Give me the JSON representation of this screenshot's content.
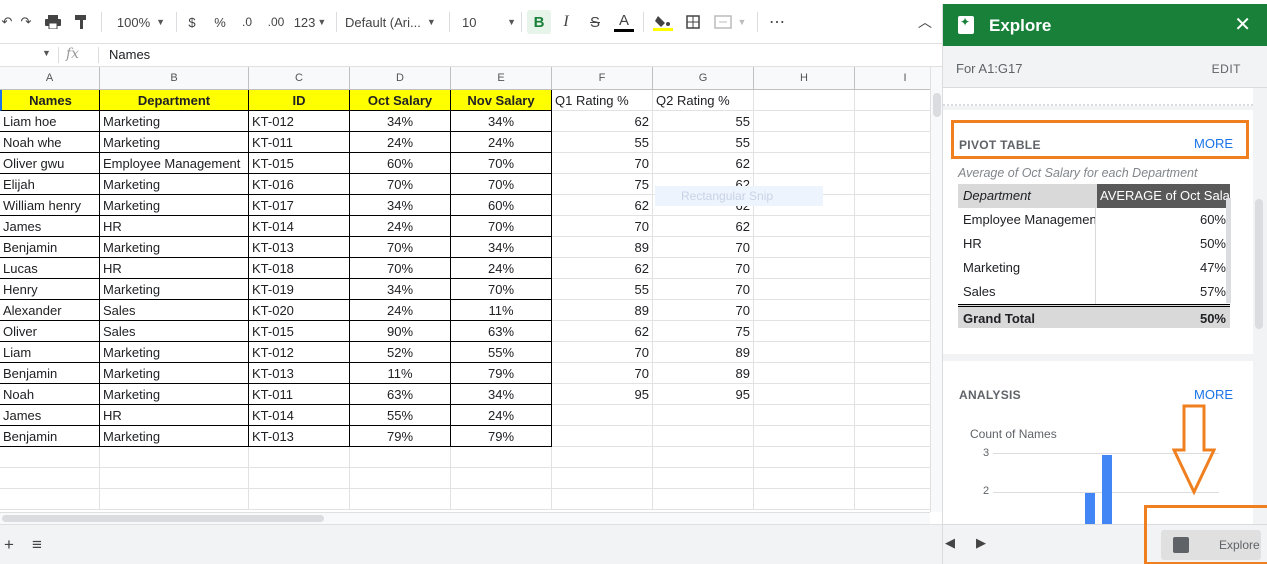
{
  "toolbar": {
    "zoom": "100%",
    "currency": "$",
    "percent": "%",
    "decrease_decimal": ".0",
    "increase_decimal": ".00",
    "number_format": "123",
    "font": "Default (Ari...",
    "font_size": "10",
    "bold": "B",
    "italic": "I",
    "strike": "S",
    "text_color": "A",
    "more": "⋯"
  },
  "formula_bar": {
    "value": "Names"
  },
  "columns": [
    "A",
    "B",
    "C",
    "D",
    "E",
    "F",
    "G",
    "H",
    "I"
  ],
  "headers": [
    "Names",
    "Department",
    "ID",
    "Oct Salary",
    "Nov Salary",
    "Q1 Rating %",
    "Q2 Rating %"
  ],
  "rows": [
    [
      "Liam hoe",
      "Marketing",
      "KT-012",
      "34%",
      "34%",
      "62",
      "55"
    ],
    [
      "Noah whe",
      "Marketing",
      "KT-011",
      "24%",
      "24%",
      "55",
      "55"
    ],
    [
      "Oliver gwu",
      "Employee Management",
      "KT-015",
      "60%",
      "70%",
      "70",
      "62"
    ],
    [
      "Elijah",
      "Marketing",
      "KT-016",
      "70%",
      "70%",
      "75",
      "62"
    ],
    [
      "William henry",
      "Marketing",
      "KT-017",
      "34%",
      "60%",
      "62",
      "62"
    ],
    [
      "James",
      "HR",
      "KT-014",
      "24%",
      "70%",
      "70",
      "62"
    ],
    [
      "Benjamin",
      "Marketing",
      "KT-013",
      "70%",
      "34%",
      "89",
      "70"
    ],
    [
      "Lucas",
      "HR",
      "KT-018",
      "70%",
      "24%",
      "62",
      "70"
    ],
    [
      "Henry",
      "Marketing",
      "KT-019",
      "34%",
      "70%",
      "55",
      "70"
    ],
    [
      "Alexander",
      "Sales",
      "KT-020",
      "24%",
      "11%",
      "89",
      "70"
    ],
    [
      "Oliver",
      "Sales",
      "KT-015",
      "90%",
      "63%",
      "62",
      "75"
    ],
    [
      "Liam",
      "Marketing",
      "KT-012",
      "52%",
      "55%",
      "70",
      "89"
    ],
    [
      "Benjamin",
      "Marketing",
      "KT-013",
      "11%",
      "79%",
      "70",
      "89"
    ],
    [
      "Noah",
      "Marketing",
      "KT-011",
      "63%",
      "34%",
      "95",
      "95"
    ],
    [
      "James",
      "HR",
      "KT-014",
      "55%",
      "24%",
      "",
      ""
    ],
    [
      "Benjamin",
      "Marketing",
      "KT-013",
      "79%",
      "79%",
      "",
      ""
    ]
  ],
  "ghost_tooltip": "Rectangular Snip",
  "explore": {
    "title": "Explore",
    "close": "✕",
    "range": "For A1:G17",
    "edit": "EDIT",
    "pivot": {
      "title": "PIVOT TABLE",
      "more": "MORE",
      "description": "Average of Oct Salary for each Department",
      "col1": "Department",
      "col2": "AVERAGE of Oct Salary",
      "rows": [
        {
          "k": "Employee Management",
          "v": "60%"
        },
        {
          "k": "HR",
          "v": "50%"
        },
        {
          "k": "Marketing",
          "v": "47%"
        },
        {
          "k": "Sales",
          "v": "57%"
        }
      ],
      "total_label": "Grand Total",
      "total_value": "50%"
    },
    "analysis": {
      "title": "ANALYSIS",
      "more": "MORE",
      "chart_label": "Count of Names",
      "ticks": [
        "3",
        "2"
      ]
    },
    "explore_button": "Explore"
  },
  "colors": {
    "header_fill": "#ffff00",
    "explore_green": "#188038",
    "annotation_orange": "#f07f1f",
    "bar_blue": "#4285f4"
  }
}
